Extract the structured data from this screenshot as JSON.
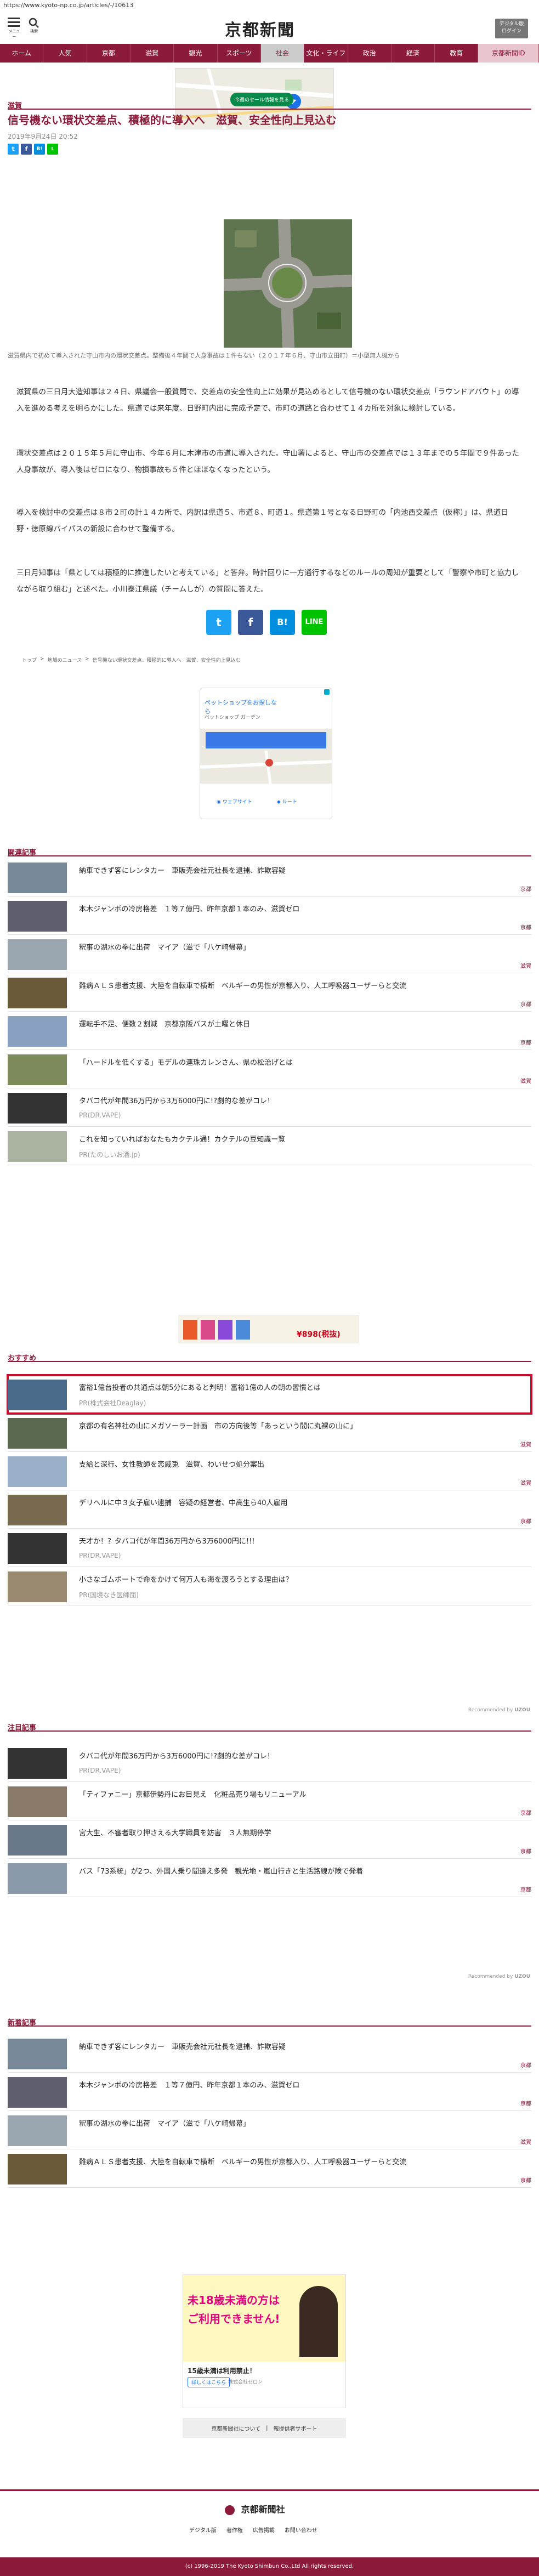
{
  "url": "https://www.kyoto-np.co.jp/articles/-/10613",
  "header": {
    "menu_label": "メニュー",
    "search_label": "検索",
    "logo": "京都新聞",
    "digital_btn_line1": "デジタル版",
    "digital_btn_line2": "ログイン"
  },
  "nav": [
    "ホーム",
    "人気",
    "京都",
    "滋賀",
    "観光",
    "スポーツ",
    "社会",
    "文化・ライフ",
    "政治",
    "経済",
    "教育",
    "京都新聞ID"
  ],
  "nav_active_index": 6,
  "ad_top": {
    "button": "今週のセール情報を見る"
  },
  "article": {
    "section": "滋賀",
    "headline": "信号機ない環状交差点、積極的に導入へ　滋賀、安全性向上見込む",
    "date": "2019年9月24日 20:52",
    "caption": "滋賀県内で初めて導入された守山市内の環状交差点。整備後４年間で人身事故は１件もない（２０１７年６月、守山市立田町）＝小型無人機から",
    "paragraphs": [
      "滋賀県の三日月大造知事は２４日、県議会一般質問で、交差点の安全性向上に効果が見込めるとして信号機のない環状交差点「ラウンドアバウト」の導入を進める考えを明らかにした。県道では来年度、日野町内出に完成予定で、市町の道路と合わせて１４カ所を対象に検討している。",
      "環状交差点は２０１５年５月に守山市、今年６月に木津市の市道に導入された。守山署によると、守山市の交差点では１３年までの５年間で９件あった人身事故が、導入後はゼロになり、物損事故も５件とほぼなくなったという。",
      "導入を検討中の交差点は８市２町の計１４カ所で、内訳は県道５、市道８、町道１。県道第１号となる日野町の「内池西交差点（仮称）」は、県道日野・徳原線バイパスの新設に合わせて整備する。",
      "三日月知事は「県としては積極的に推進したいと考えている」と答弁。時計回りに一方通行するなどのルールの周知が重要として「警察や市町と協力しながら取り組む」と述べた。小川泰江県議（チームしが）の質問に答えた。"
    ],
    "breadcrumb": [
      "トップ",
      "地域のニュース",
      "信号機ない環状交差点、積極的に導入へ　滋賀、安全性向上見込む"
    ]
  },
  "map_ad": {
    "title": "ペットショップをお探しなら",
    "sub": "ペットショップ ガーデン",
    "btn1": "ウェブサイト",
    "btn2": "ルート"
  },
  "related": {
    "title": "関連記事",
    "items": [
      {
        "title": "納車できず客にレンタカー　車販売会社元社長を逮捕、詐欺容疑",
        "tag": "京都",
        "thumb": "#778899"
      },
      {
        "title": "本木ジャンボの冷房格差　１等７億円、昨年京都１本のみ、滋賀ゼロ",
        "tag": "京都",
        "thumb": "#5f5f6f"
      },
      {
        "title": "釈事の湖水の拳に出荷　マイア（滋で「八ケ崎帰幕」",
        "tag": "滋賀",
        "thumb": "#9aa7b0"
      },
      {
        "title": "難病ＡＬＳ患者支援、大陸を自転車で横断　ベルギーの男性が京都入り、人工呼吸器ユーザーらと交流",
        "tag": "京都",
        "thumb": "#6a5a3a"
      },
      {
        "title": "運転手不足、便数２割減　京都京阪バスが土曜と休日",
        "tag": "京都",
        "thumb": "#8aa0c0"
      },
      {
        "title": "「ハードルを低くする」モデルの連珠カレンさん、県の松治げとは",
        "tag": "滋賀",
        "thumb": "#7c8a5c"
      },
      {
        "title": "タバコ代が年間36万円から3万6000円に!?劇的な差がコレ！",
        "src": "PR(DR.VAPE)",
        "thumb": "#333333"
      },
      {
        "title": "これを知っていればおなたもカクテル通！カクテルの豆知識ー覧",
        "src": "PR(たのしいお酒.jp)",
        "thumb": "#aab4a0"
      }
    ]
  },
  "banner": {
    "price": "¥898(税抜)"
  },
  "osusume": {
    "title": "おすすめ",
    "items": [
      {
        "title": "富裕1億台投者の共通点は朝5分にあると判明！富裕1億の人の朝の習慣とは",
        "src": "PR(株式会社Deaglay)",
        "thumb": "#4a6a8a",
        "highlight": true
      },
      {
        "title": "京都の有名神社の山にメガソーラー計画　市の方向後等「あっという間に丸裸の山に」",
        "tag": "滋賀",
        "thumb": "#5a6a50"
      },
      {
        "title": "支給と深行、女性教師を恋威兎　滋賀、わいせつ処分案出",
        "tag": "滋賀",
        "thumb": "#9ab0c8"
      },
      {
        "title": "デリヘルに中３女子雇い逮捕　容疑の経営者、中高生ら40人雇用",
        "tag": "京都",
        "thumb": "#7a6a50"
      },
      {
        "title": "天才か！？タバコ代が年間36万円から3万6000円に!!!",
        "src": "PR(DR.VAPE)",
        "thumb": "#333333"
      },
      {
        "title": "小さなゴムボートで命をかけて何万人も海を渡ろうとする理由は？",
        "src": "PR(国境なき医師団)",
        "thumb": "#9a8a70"
      }
    ],
    "recommended_by": "Recommended by ",
    "recommended_brand": "UZOU"
  },
  "chumoku": {
    "title": "注目記事",
    "items": [
      {
        "title": "タバコ代が年間36万円から3万6000円に!?劇的な差がコレ！",
        "src": "PR(DR.VAPE)",
        "thumb": "#333333"
      },
      {
        "title": "「ティファニー」京都伊勢丹にお目見え　化粧品売り場もリニューアル",
        "tag": "京都",
        "thumb": "#8a7a6a"
      },
      {
        "title": "宮大生、不審者取り押さえる大学職員を妨害　３人無期停学",
        "tag": "京都",
        "thumb": "#6a7a8a"
      },
      {
        "title": "バス「73系統」が2つ、外国人乗り間違え多発　観光地・嵐山行きと生活路線が険で発着",
        "tag": "京都",
        "thumb": "#8a9aaa"
      }
    ],
    "recommended_by": "Recommended by ",
    "recommended_brand": "UZOU"
  },
  "shincha": {
    "title": "新着記事",
    "items": [
      {
        "title": "納車できず客にレンタカー　車販売会社元社長を逮捕、詐欺容疑",
        "tag": "京都",
        "thumb": "#778899"
      },
      {
        "title": "本木ジャンボの冷房格差　１等７億円、昨年京都１本のみ、滋賀ゼロ",
        "tag": "京都",
        "thumb": "#5f5f6f"
      },
      {
        "title": "釈事の湖水の拳に出荷　マイア（滋で「八ケ崎帰幕」",
        "tag": "滋賀",
        "thumb": "#9aa7b0"
      },
      {
        "title": "難病ＡＬＳ患者支援、大陸を自転車で横断　ベルギーの男性が京都入り、人工呼吸器ユーザーらと交流",
        "tag": "京都",
        "thumb": "#6a5a3a"
      }
    ]
  },
  "bottom_ad": {
    "headline1": "未18歳未満の方は",
    "headline2": "ご利用できません!",
    "text": "15歳未満は利用禁止！",
    "sponsor": "株式会社ゼロン",
    "more": "詳しくはこちら"
  },
  "footer": {
    "links_box": [
      "京都新聞社について",
      "報提供者サポート"
    ],
    "logo": "京都新聞社",
    "links": [
      "デジタル版",
      "著作権",
      "広告掲載",
      "お問い合わせ"
    ],
    "copyright": "(c) 1996-2019 The Kyoto Shimbun Co.,Ltd All rights reserved."
  },
  "colors": {
    "brand": "#8c1a3a",
    "twitter": "#1da1f2",
    "facebook": "#3b5998",
    "hatena": "#008fde",
    "line": "#00c300"
  }
}
